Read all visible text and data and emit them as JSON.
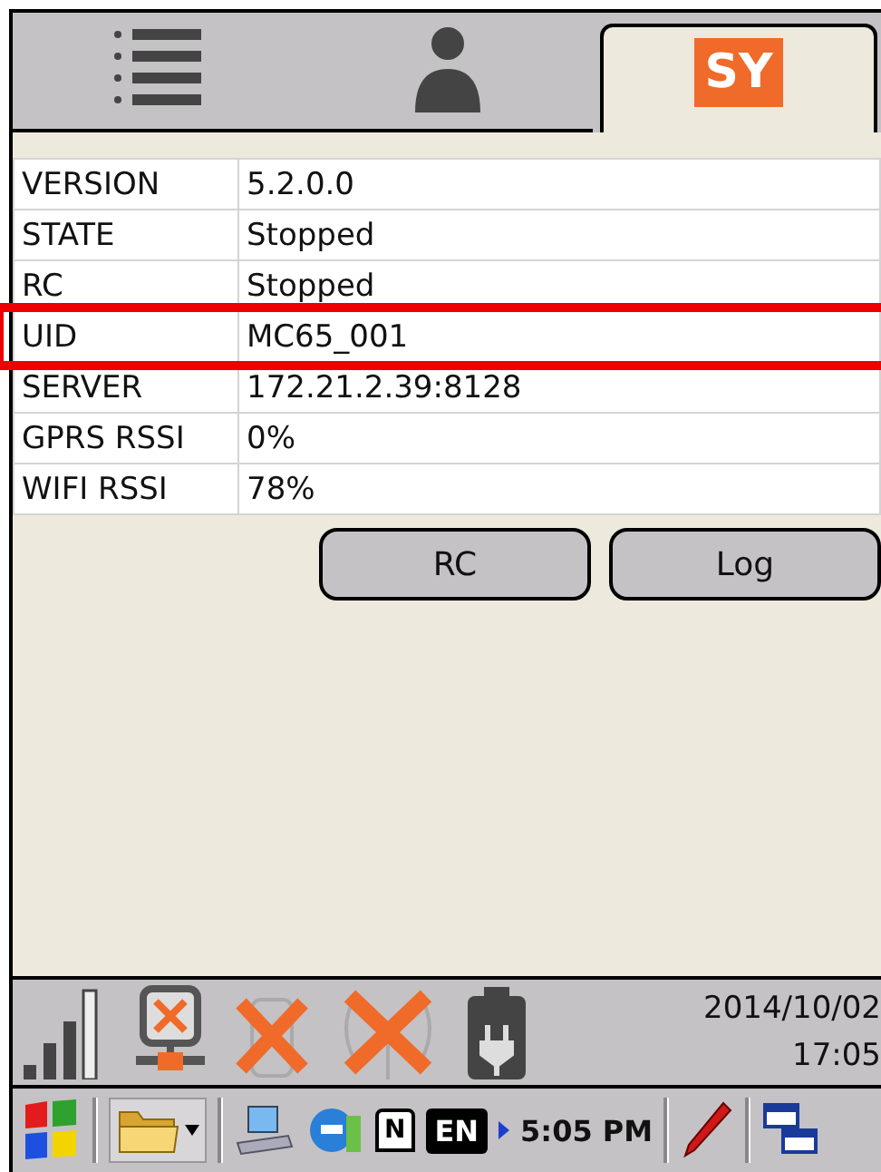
{
  "tabs": [
    {
      "kind": "list",
      "selected": false
    },
    {
      "kind": "person",
      "selected": false
    },
    {
      "kind": "logo",
      "label": "SY",
      "selected": true
    }
  ],
  "rows": [
    {
      "key": "VERSION",
      "value": "5.2.0.0",
      "highlighted": false
    },
    {
      "key": "STATE",
      "value": "Stopped",
      "highlighted": false
    },
    {
      "key": "RC",
      "value": "Stopped",
      "highlighted": false
    },
    {
      "key": "UID",
      "value": "MC65_001",
      "highlighted": true
    },
    {
      "key": "SERVER",
      "value": "172.21.2.39:8128",
      "highlighted": false
    },
    {
      "key": "GPRS RSSI",
      "value": "0%",
      "highlighted": false
    },
    {
      "key": "WIFI RSSI",
      "value": "78%",
      "highlighted": false
    }
  ],
  "buttons": [
    "RC",
    "Log"
  ],
  "status_bar": {
    "date": "2014/10/02",
    "time": "17:05"
  },
  "taskbar": {
    "tray_badge": "N",
    "language": "EN",
    "clock": "5:05 PM"
  }
}
